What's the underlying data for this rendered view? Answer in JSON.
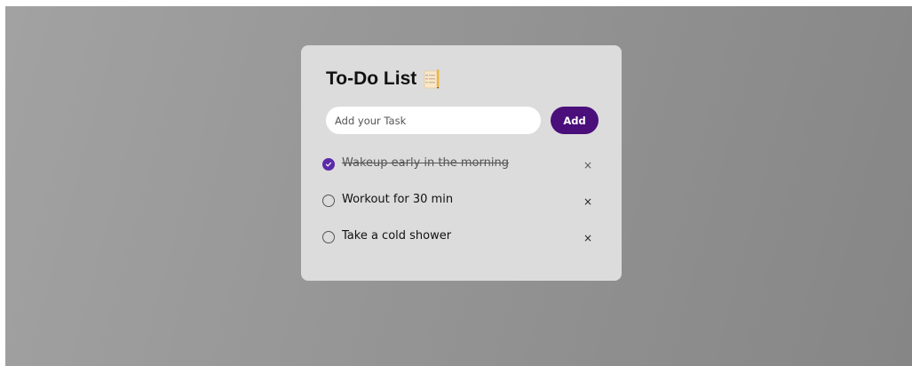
{
  "app": {
    "title": "To-Do List",
    "title_icon": "notepad-emoji-icon",
    "accent_color": "#4a0f7a"
  },
  "input": {
    "value": "",
    "placeholder": "Add your Task"
  },
  "add_button": {
    "label": "Add"
  },
  "tasks": [
    {
      "text": "Wakeup early in the morning",
      "completed": true,
      "delete_label": "×"
    },
    {
      "text": "Workout for 30 min",
      "completed": false,
      "delete_label": "×"
    },
    {
      "text": "Take a cold shower",
      "completed": false,
      "delete_label": "×"
    }
  ]
}
